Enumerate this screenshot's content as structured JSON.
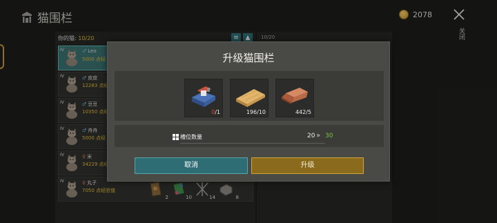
{
  "header": {
    "title": "猫围栏",
    "coins": "2078",
    "close_label": "关闭"
  },
  "list": {
    "capacity_label": "你的猫:",
    "capacity_value": "10/20",
    "right_header": "10/20",
    "cats": [
      {
        "level": "IV",
        "sex": "♂",
        "name": "Leo",
        "xp": "5000 点经",
        "selected": true
      },
      {
        "level": "IV",
        "sex": "♂",
        "name": "皮皮",
        "xp": "12283 点经"
      },
      {
        "level": "IV",
        "sex": "♂",
        "name": "豆豆",
        "xp": "10350 点经"
      },
      {
        "level": "IV",
        "sex": "♂",
        "name": "舟舟",
        "xp": "5000 点经"
      },
      {
        "level": "IV",
        "sex": "♀",
        "name": "米",
        "xp": "34229 点经"
      },
      {
        "level": "IV",
        "sex": "♀",
        "name": "丸子",
        "xp": "7050 点经验值"
      }
    ],
    "bottom_items": [
      {
        "icon": "feed-bag-icon",
        "qty": "2"
      },
      {
        "icon": "cat-toy-icon",
        "qty": "10"
      },
      {
        "icon": "sticks-icon",
        "qty": "14"
      },
      {
        "icon": "stone-block-icon",
        "qty": "8"
      }
    ]
  },
  "modal": {
    "title": "升级猫围栏",
    "materials": [
      {
        "icon": "workbench-kit-icon",
        "have": "0",
        "need": "/1"
      },
      {
        "icon": "wooden-plank-icon",
        "qty": "196/10"
      },
      {
        "icon": "copper-ingot-icon",
        "qty": "442/5"
      }
    ],
    "stat": {
      "label": "槽位数量",
      "old_value": "20",
      "arrow": "»",
      "new_value": "30"
    },
    "cancel_label": "取消",
    "upgrade_label": "升级"
  },
  "colors": {
    "accent_gold": "#e0b63d",
    "cancel": "#2f6d74",
    "upgrade": "#8a6a1c",
    "increase": "#79c43d",
    "insufficient": "#e0453b"
  }
}
